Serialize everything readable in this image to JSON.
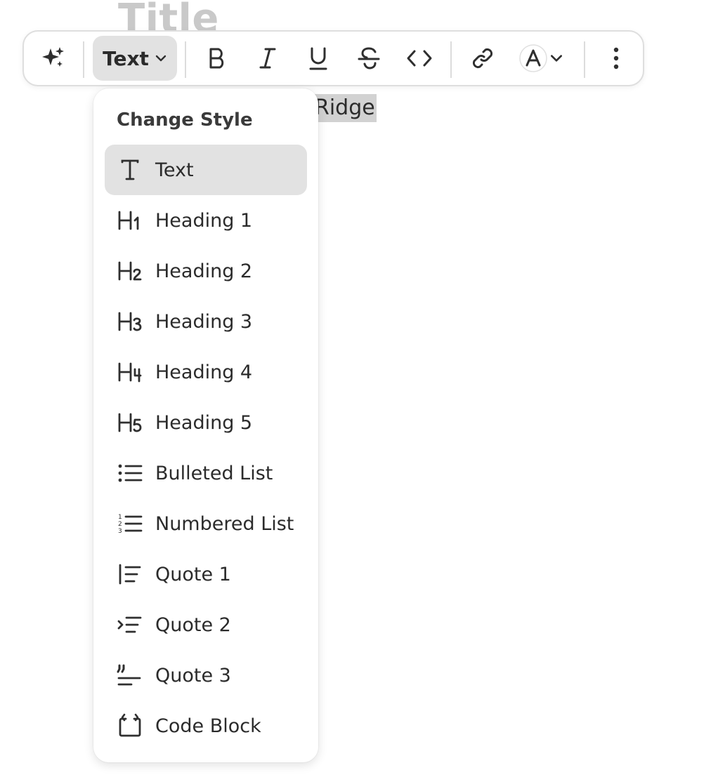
{
  "document": {
    "title": "Title",
    "selected_text": "Ridge"
  },
  "toolbar": {
    "style_button_label": "Text",
    "items": [
      {
        "name": "ai-sparkle",
        "icon": "sparkle-icon"
      },
      {
        "name": "bold",
        "icon": "bold-icon"
      },
      {
        "name": "italic",
        "icon": "italic-icon"
      },
      {
        "name": "underline",
        "icon": "underline-icon"
      },
      {
        "name": "strikethrough",
        "icon": "strikethrough-icon"
      },
      {
        "name": "code",
        "icon": "code-icon"
      },
      {
        "name": "link",
        "icon": "link-icon"
      },
      {
        "name": "text-color",
        "icon": "text-color-icon"
      },
      {
        "name": "more",
        "icon": "more-vertical-icon"
      }
    ]
  },
  "menu": {
    "header": "Change Style",
    "items": [
      {
        "label": "Text",
        "icon": "text-icon",
        "selected": true
      },
      {
        "label": "Heading 1",
        "icon": "heading-1-icon"
      },
      {
        "label": "Heading 2",
        "icon": "heading-2-icon"
      },
      {
        "label": "Heading 3",
        "icon": "heading-3-icon"
      },
      {
        "label": "Heading 4",
        "icon": "heading-4-icon"
      },
      {
        "label": "Heading 5",
        "icon": "heading-5-icon"
      },
      {
        "label": "Bulleted List",
        "icon": "bulleted-list-icon"
      },
      {
        "label": "Numbered List",
        "icon": "numbered-list-icon"
      },
      {
        "label": "Quote 1",
        "icon": "quote-1-icon"
      },
      {
        "label": "Quote 2",
        "icon": "quote-2-icon"
      },
      {
        "label": "Quote 3",
        "icon": "quote-3-icon"
      },
      {
        "label": "Code Block",
        "icon": "code-block-icon"
      }
    ]
  },
  "colors": {
    "selection_bg": "#d2d2d2",
    "selected_item_bg": "#e2e2e2",
    "icon": "#2f2f2f"
  }
}
